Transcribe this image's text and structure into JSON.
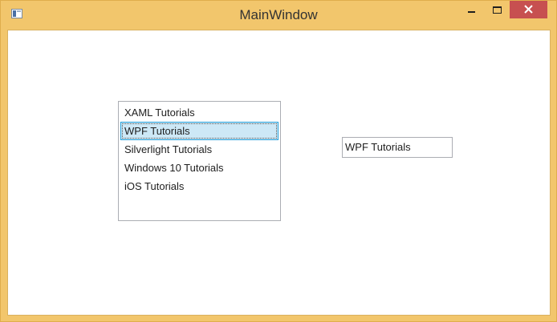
{
  "window": {
    "title": "MainWindow",
    "frame_color": "#f2c66c",
    "close_color": "#c75050"
  },
  "icons": {
    "app": "app-window-icon",
    "minimize": "minimize-icon",
    "maximize": "maximize-icon",
    "close": "close-icon"
  },
  "listbox": {
    "items": [
      {
        "label": "XAML Tutorials",
        "selected": false
      },
      {
        "label": "WPF Tutorials",
        "selected": true
      },
      {
        "label": "Silverlight Tutorials",
        "selected": false
      },
      {
        "label": "Windows 10 Tutorials",
        "selected": false
      },
      {
        "label": "iOS Tutorials",
        "selected": false
      }
    ],
    "selection_color": "#cde8f6"
  },
  "textbox": {
    "value": "WPF Tutorials"
  }
}
